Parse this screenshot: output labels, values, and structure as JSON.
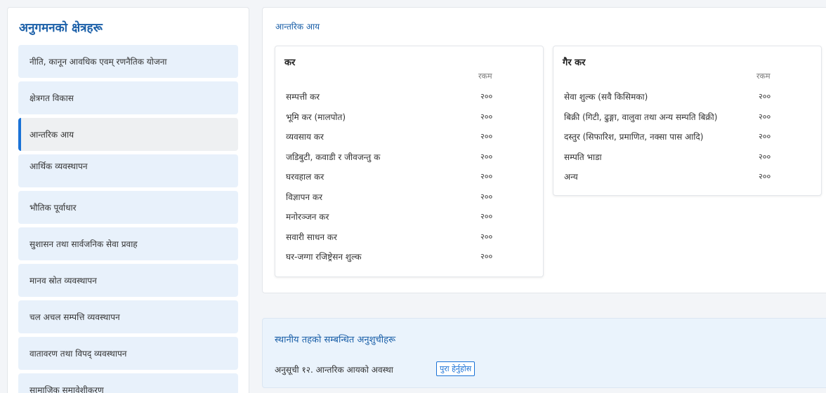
{
  "sidebar": {
    "title": "अनुगमनको क्षेत्रहरू",
    "items": [
      {
        "label": "नीति, कानून आवधिक एवम् रणनैतिक योजना"
      },
      {
        "label": "क्षेत्रगत विकास"
      },
      {
        "label": "आन्तरिक आय"
      },
      {
        "label": "आर्थिक व्यवस्थापन"
      },
      {
        "label": "भौतिक पूर्वाधार"
      },
      {
        "label": "सुशासन तथा सार्वजनिक सेवा प्रवाह"
      },
      {
        "label": "मानव स्रोत व्यवस्थापन"
      },
      {
        "label": "चल अचल सम्पत्ति व्यवस्थापन"
      },
      {
        "label": "वातावरण तथा विपद् व्यवस्थापन"
      },
      {
        "label": "सामाजिक समावेशीकरण"
      }
    ],
    "active_index": 2
  },
  "main": {
    "title": "आन्तरिक आय",
    "tax": {
      "heading": "कर",
      "amount_header": "रकम",
      "rows": [
        {
          "name": "सम्पत्ती कर",
          "amount": "२००"
        },
        {
          "name": "भूमि कर (मालपोत)",
          "amount": "२००"
        },
        {
          "name": "व्यवसाय कर",
          "amount": "२००"
        },
        {
          "name": "जडिबुटी, कवाडी र जीवजन्तु क",
          "amount": "२००"
        },
        {
          "name": "घरवहाल कर",
          "amount": "२००"
        },
        {
          "name": "विज्ञापन कर",
          "amount": "२००"
        },
        {
          "name": "मनोरञ्जन कर",
          "amount": "२००"
        },
        {
          "name": "सवारी साधन कर",
          "amount": "२००"
        },
        {
          "name": "घर-जग्गा रजिष्ट्रेसन शुल्क",
          "amount": "२००"
        }
      ]
    },
    "non_tax": {
      "heading": "गैर कर",
      "amount_header": "रकम",
      "rows": [
        {
          "name": "सेवा शुल्क (सवै किसिमका)",
          "amount": "२००"
        },
        {
          "name": "बिक्री (गिटी, ढुङ्गा, वालुवा तथा अन्य सम्पति बिक्री)",
          "amount": "२००"
        },
        {
          "name": "दस्तुर (सिफारिश, प्रमाणित, नक्सा पास आदि)",
          "amount": "२००"
        },
        {
          "name": "सम्पति भाडा",
          "amount": "२००"
        },
        {
          "name": "अन्य",
          "amount": "२००"
        }
      ]
    }
  },
  "annex": {
    "title": "स्थानीय तहको सम्बन्धित अनुशुचीहरू",
    "item_text": "अनुसूची १२. आन्तरिक आयको अवस्था",
    "more_label": "पुरा हेर्नुहोस"
  },
  "colors": {
    "accent": "#1a72d6",
    "title_blue": "#1a5fa8",
    "sidebar_item_bg": "#e8f1fb",
    "annex_bg": "#eaf3fc"
  }
}
